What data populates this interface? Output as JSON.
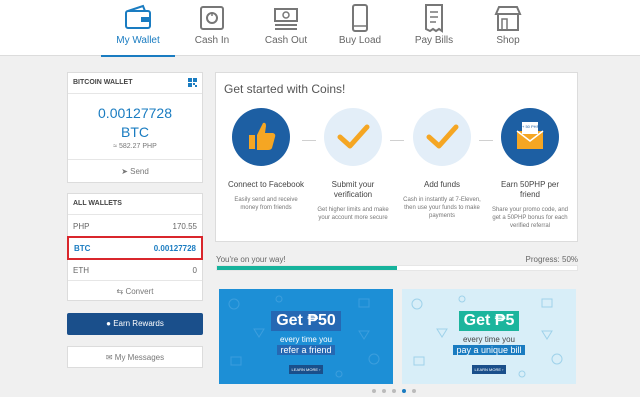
{
  "nav": {
    "items": [
      {
        "label": "My Wallet",
        "icon": "wallet-icon"
      },
      {
        "label": "Cash In",
        "icon": "safe-icon"
      },
      {
        "label": "Cash Out",
        "icon": "cash-icon"
      },
      {
        "label": "Buy Load",
        "icon": "phone-icon"
      },
      {
        "label": "Pay Bills",
        "icon": "receipt-icon"
      },
      {
        "label": "Shop",
        "icon": "store-icon"
      }
    ],
    "active": "My Wallet"
  },
  "bitcoin_wallet": {
    "header": "BITCOIN WALLET",
    "amount": "0.00127728",
    "currency": "BTC",
    "php_value": "≈ 582.27 PHP",
    "send_label": "Send"
  },
  "all_wallets": {
    "header": "ALL WALLETS",
    "rows": [
      {
        "name": "PHP",
        "value": "170.55"
      },
      {
        "name": "BTC",
        "value": "0.00127728"
      },
      {
        "name": "ETH",
        "value": "0"
      }
    ],
    "convert_label": "Convert"
  },
  "earn_rewards_label": "Earn Rewards",
  "my_messages_label": "My Messages",
  "get_started": {
    "title": "Get started with Coins!",
    "steps": [
      {
        "title": "Connect to Facebook",
        "desc": "Easily send and receive money from friends"
      },
      {
        "title": "Submit your verification",
        "desc": "Get higher limits and make your account more secure"
      },
      {
        "title": "Add funds",
        "desc": "Cash in instantly at 7-Eleven, then use your funds to make payments"
      },
      {
        "title": "Earn 50PHP per friend",
        "desc": "Share your promo code, and get a 50PHP bonus for each verified referral"
      }
    ],
    "envelope_text": "+ 50 PHP"
  },
  "progress": {
    "message": "You're on your way!",
    "label": "Progress: 50%",
    "value": 0.5
  },
  "banners": [
    {
      "headline": "Get ₱50",
      "line1": "every time you",
      "line2": "refer a friend",
      "button": "LEARN MORE ›"
    },
    {
      "headline": "Get ₱5",
      "line1": "every time you",
      "line2": "pay a unique bill",
      "button": "LEARN MORE ›"
    }
  ],
  "carousel": {
    "count": 5,
    "active_index": 3
  },
  "colors": {
    "accent": "#1a7cc1",
    "primary_dark": "#1a4f8b",
    "progress_fill": "#17b39c",
    "selection_border": "#d9262c",
    "step_circle": "#1d5fa3",
    "check_orange": "#f5a623"
  }
}
